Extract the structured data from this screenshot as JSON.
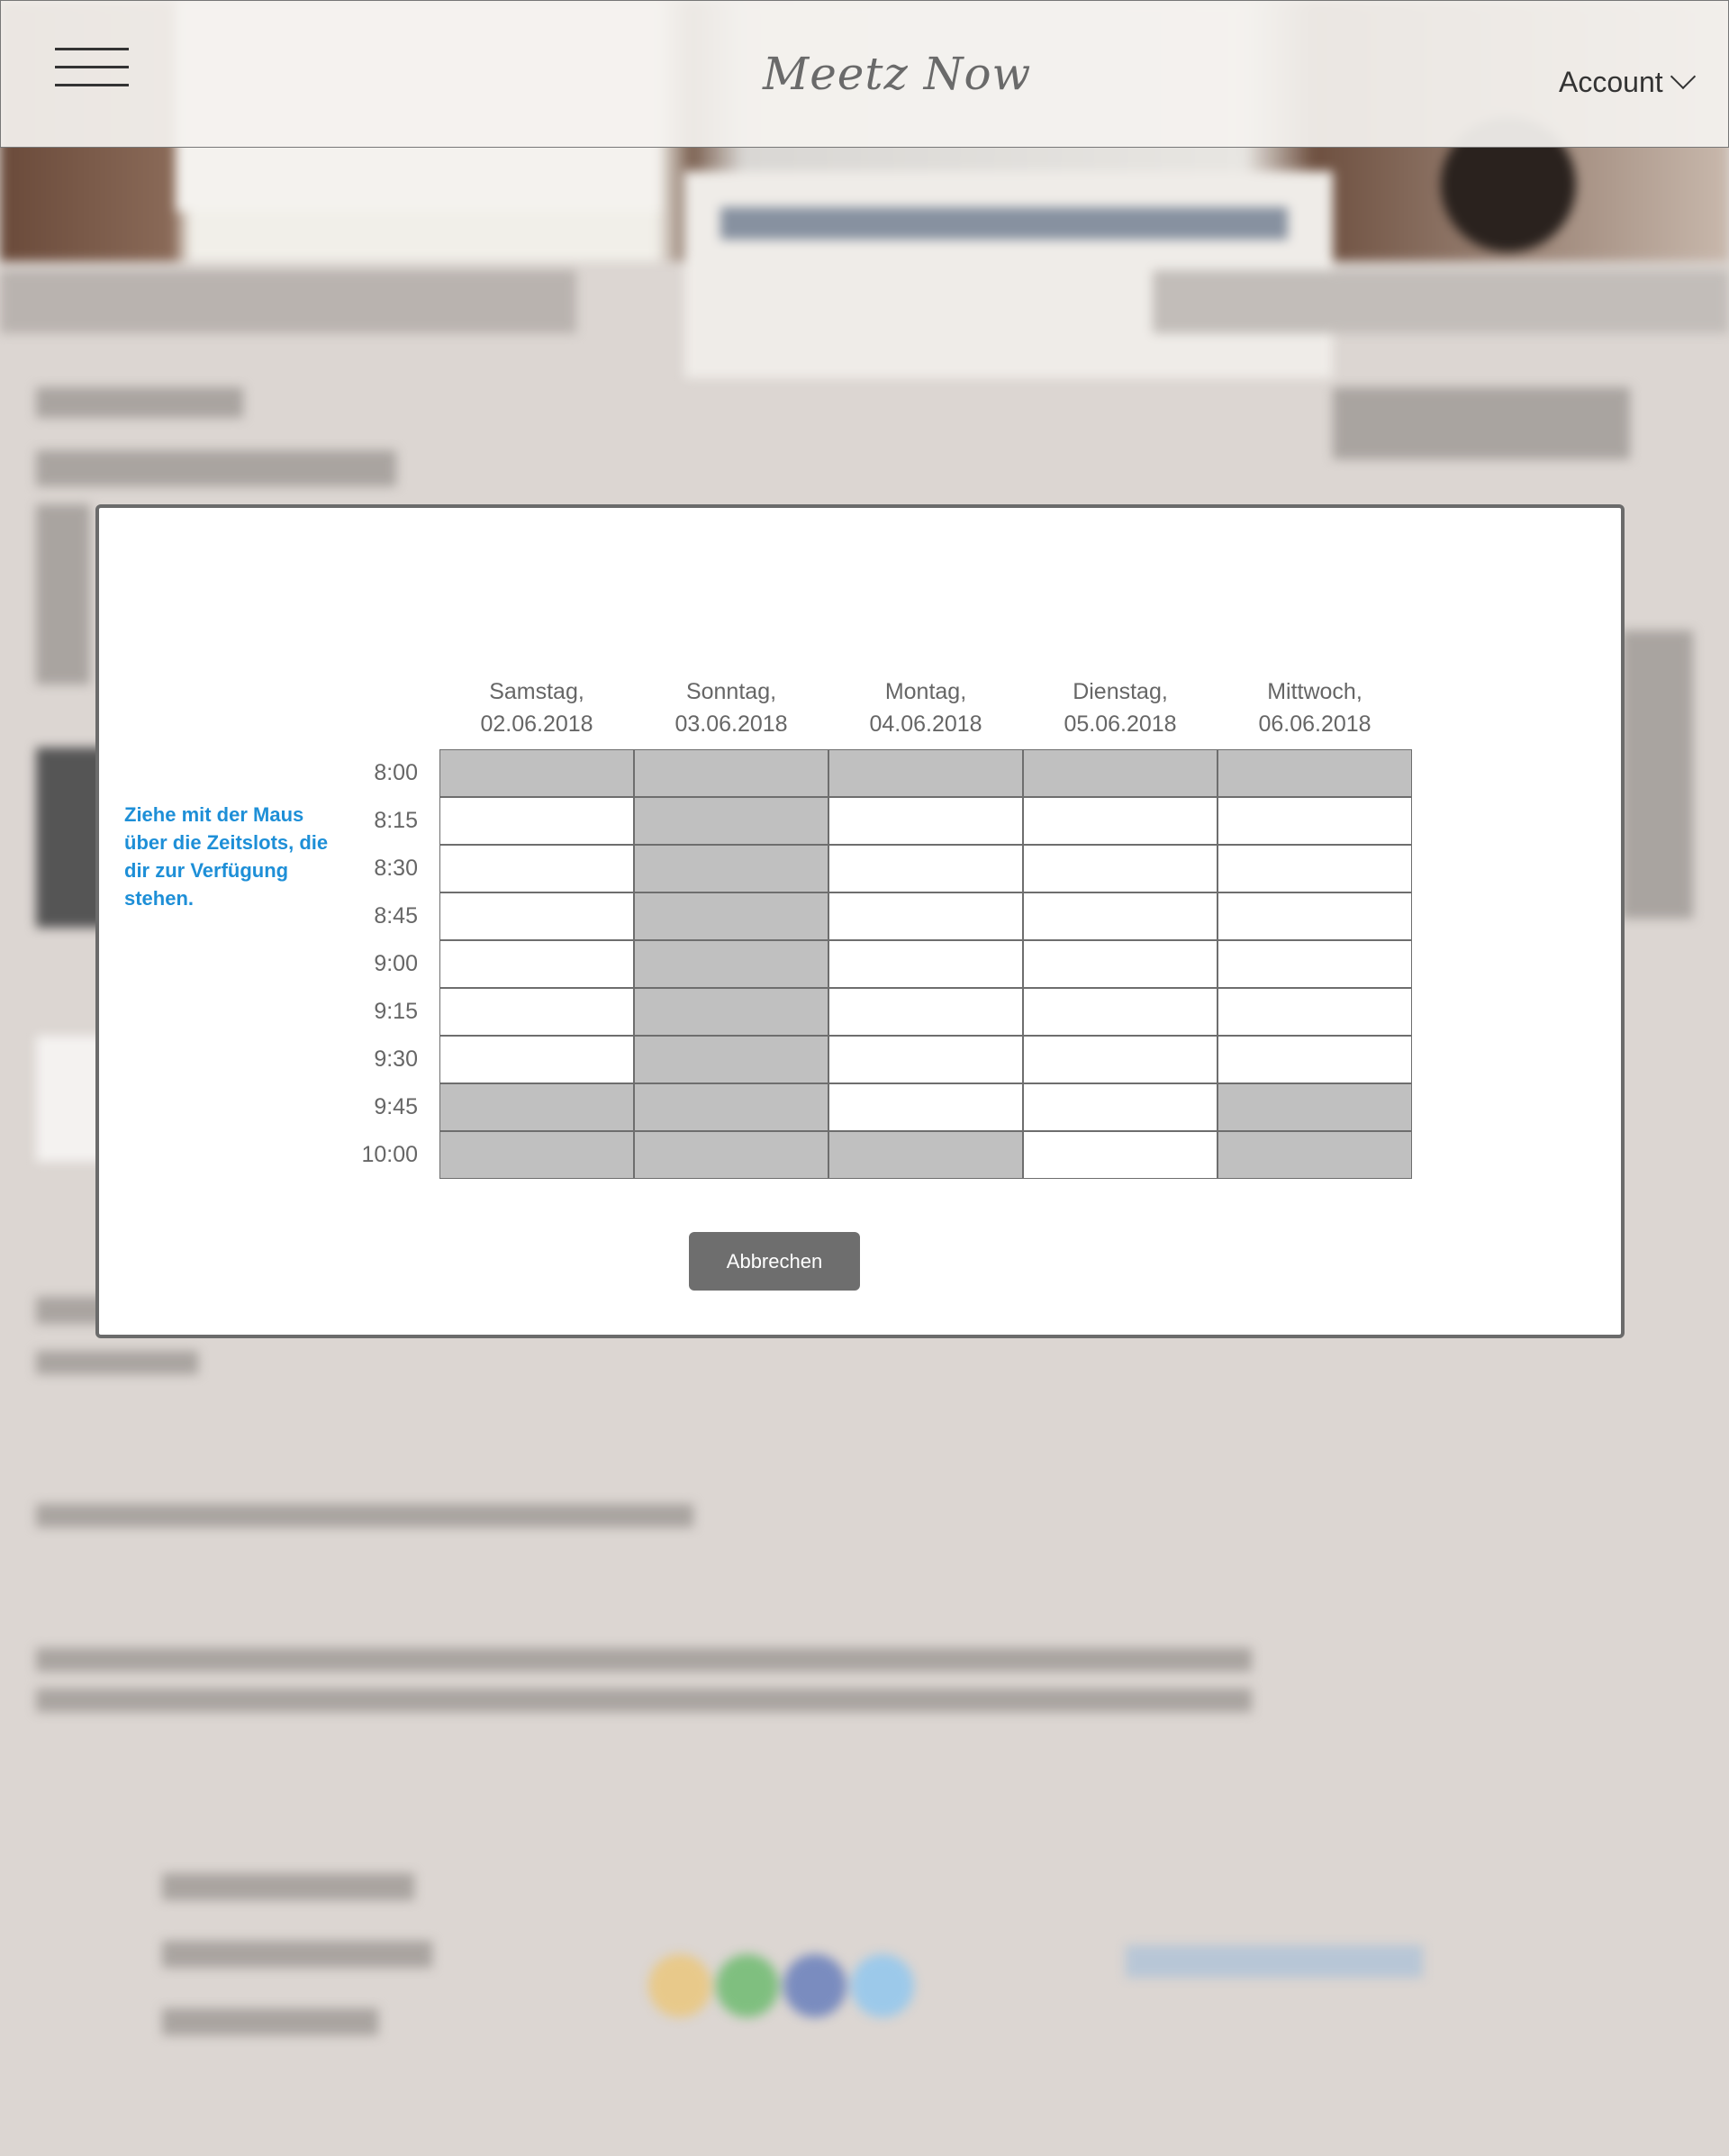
{
  "header": {
    "logo": "Meetz Now",
    "account_label": "Account"
  },
  "modal": {
    "hint": "Ziehe mit der Maus über die Zeitslots, die dir zur Verfügung stehen.",
    "days": [
      {
        "weekday": "Samstag,",
        "date": "02.06.2018"
      },
      {
        "weekday": "Sonntag,",
        "date": "03.06.2018"
      },
      {
        "weekday": "Montag,",
        "date": "04.06.2018"
      },
      {
        "weekday": "Dienstag,",
        "date": "05.06.2018"
      },
      {
        "weekday": "Mittwoch,",
        "date": "06.06.2018"
      }
    ],
    "times": [
      "8:00",
      "8:15",
      "8:30",
      "8:45",
      "9:00",
      "9:15",
      "9:30",
      "9:45",
      "10:00"
    ],
    "slots": [
      [
        "busy",
        "busy",
        "busy",
        "busy",
        "busy"
      ],
      [
        "free",
        "busy",
        "free",
        "free",
        "free"
      ],
      [
        "free",
        "busy",
        "free",
        "free",
        "free"
      ],
      [
        "free",
        "busy",
        "free",
        "free",
        "free"
      ],
      [
        "free",
        "busy",
        "free",
        "free",
        "free"
      ],
      [
        "free",
        "busy",
        "free",
        "free",
        "free"
      ],
      [
        "free",
        "busy",
        "free",
        "free",
        "free"
      ],
      [
        "busy",
        "busy",
        "free",
        "free",
        "busy"
      ],
      [
        "busy",
        "busy",
        "busy",
        "free",
        "busy"
      ]
    ],
    "cancel_label": "Abbrechen"
  },
  "colors": {
    "hint": "#1e8fd7",
    "busy_slot": "#c0c0c0",
    "free_slot": "#ffffff",
    "button": "#6e6e6e"
  }
}
